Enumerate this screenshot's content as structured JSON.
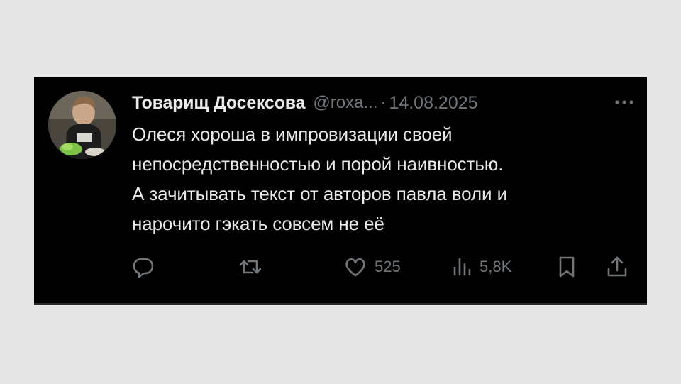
{
  "tweet": {
    "author": {
      "display_name": "Товарищ Досексова",
      "handle": "@roxa...",
      "avatar_icon": "user-avatar-photo"
    },
    "separator": "·",
    "date": "14.08.2025",
    "body_lines": [
      "Олеся хороша в импровизации своей",
      "непосредственностью и порой наивностью.",
      "А зачитывать текст от авторов павла воли и",
      "нарочито гэкать совсем не её"
    ],
    "actions": {
      "reply": {
        "icon": "reply-icon",
        "count": ""
      },
      "retweet": {
        "icon": "retweet-icon",
        "count": ""
      },
      "like": {
        "icon": "heart-icon",
        "count": "525"
      },
      "views": {
        "icon": "views-icon",
        "count": "5,8K"
      },
      "bookmark": {
        "icon": "bookmark-icon"
      },
      "share": {
        "icon": "share-icon"
      }
    }
  },
  "colors": {
    "page_background": "#e6e6e6",
    "card_background": "#000000",
    "primary_text": "#e7e9ea",
    "secondary_text": "#71767b"
  }
}
